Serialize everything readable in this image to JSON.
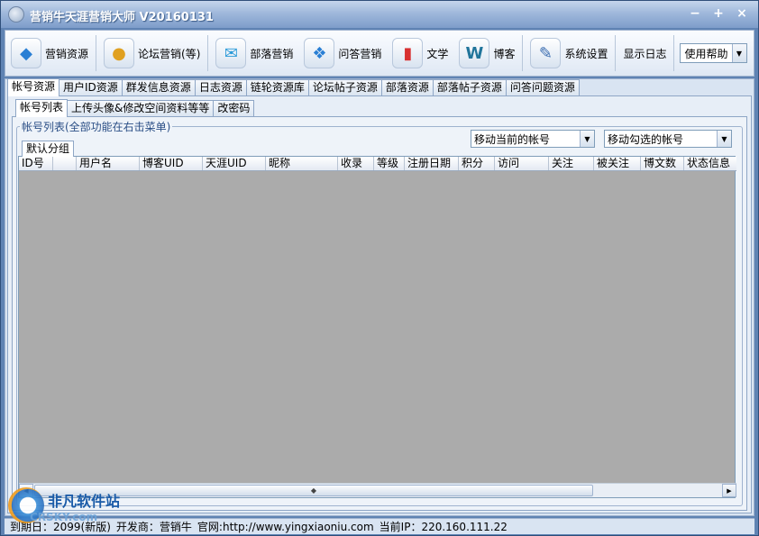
{
  "window": {
    "title": "营销牛天涯营销大师 V20160131",
    "controls": [
      "−",
      "+",
      "×"
    ]
  },
  "toolbar": {
    "items": [
      {
        "label": "营销资源",
        "icon": "dropbox-icon",
        "glyph": "◆"
      },
      {
        "label": "论坛营销(等)",
        "icon": "forum-mascot-icon",
        "glyph": "●"
      },
      {
        "label": "部落营销",
        "icon": "mail-icon",
        "glyph": "✉"
      },
      {
        "label": "问答营销",
        "icon": "qa-icon",
        "glyph": "❖"
      },
      {
        "label": "文学",
        "icon": "bars-icon",
        "glyph": "▮"
      },
      {
        "label": "博客",
        "icon": "wordpress-icon",
        "glyph": "W"
      },
      {
        "label": "系统设置",
        "icon": "wrench-icon",
        "glyph": "✎"
      }
    ],
    "show_log": "显示日志",
    "help_select": "使用帮助"
  },
  "main_tabs": [
    "帐号资源",
    "用户ID资源",
    "群发信息资源",
    "日志资源",
    "链轮资源库",
    "论坛帖子资源",
    "部落资源",
    "部落帖子资源",
    "问答问题资源"
  ],
  "sub_tabs": [
    "帐号列表",
    "上传头像&修改空间资料等等",
    "改密码"
  ],
  "account_list": {
    "legend": "帐号列表(全部功能在右击菜单)",
    "move_current": "移动当前的帐号",
    "move_checked": "移动勾选的帐号",
    "group_tab": "默认分组",
    "columns": [
      "ID号",
      "",
      "用户名",
      "博客UID",
      "天涯UID",
      "昵称",
      "收录",
      "等级",
      "注册日期",
      "积分",
      "访问",
      "关注",
      "被关注",
      "博文数",
      "状态信息"
    ]
  },
  "statusbar": {
    "expire": "到期日：2099(新版)",
    "developer": "开发商：营销牛",
    "website": "官网:http://www.yingxiaoniu.com",
    "ip": "当前IP：220.160.111.22"
  },
  "watermark": {
    "text": "非凡软件站",
    "sub": "CRSKY.com"
  }
}
